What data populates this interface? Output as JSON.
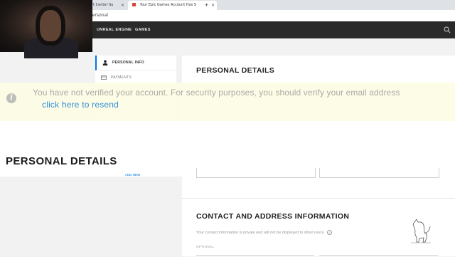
{
  "browser": {
    "tabs": [
      {
        "label": "ort Center Su"
      },
      {
        "label": "Your Epic Games Account Has S"
      }
    ],
    "url": "personal"
  },
  "topnav": {
    "items": [
      "UNREAL ENGINE",
      "GAMES"
    ]
  },
  "sidebar": {
    "items": [
      {
        "label": "PERSONAL INFO",
        "icon": "person-icon",
        "active": true
      },
      {
        "label": "PAYMENTS",
        "icon": "credit-card-icon",
        "active": false
      }
    ],
    "add_link": "ADD NEW"
  },
  "panel": {
    "title": "PERSONAL DETAILS",
    "contact_title": "CONTACT AND ADDRESS INFORMATION",
    "contact_desc": "Your contact information is private and will not be displayed to other users.",
    "optional_label": "OPTIONAL"
  },
  "banner": {
    "message": "You have not verified your account. For security purposes, you should verify your email address",
    "link": "click here to resend",
    "icon": "info-icon"
  },
  "overlay_title": "PERSONAL DETAILS",
  "colors": {
    "accent": "#0074e4",
    "nav_bg": "#2a2a2a",
    "banner_bg": "#fdfce6",
    "link": "#2f8fd8"
  }
}
